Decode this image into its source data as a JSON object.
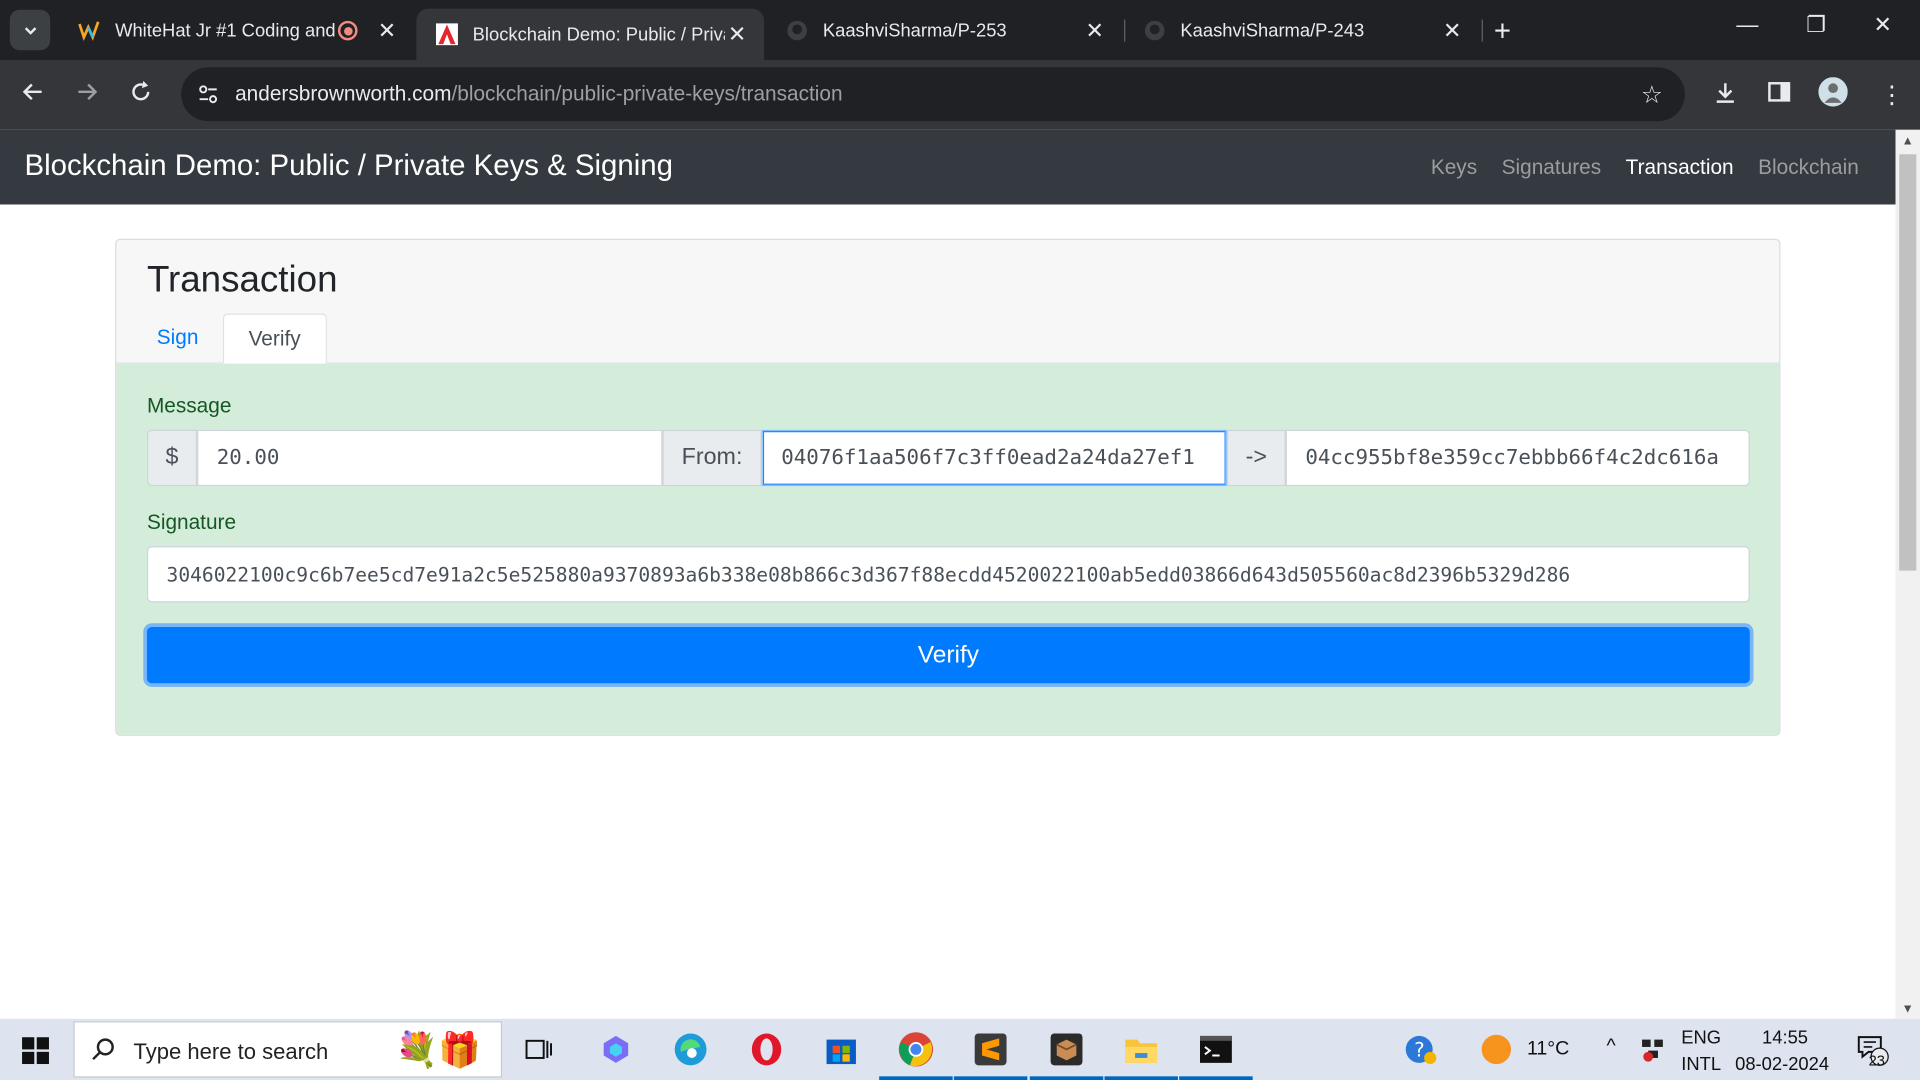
{
  "browser": {
    "tabs": [
      {
        "title": "WhiteHat Jr #1 Coding and",
        "favicon": "whitehat-logo",
        "active": false
      },
      {
        "title": "Blockchain Demo: Public / Priva",
        "favicon": "adobe-logo",
        "active": true
      },
      {
        "title": "KaashviSharma/P-253",
        "favicon": "github-logo",
        "active": false
      },
      {
        "title": "KaashviSharma/P-243",
        "favicon": "github-logo",
        "active": false
      }
    ],
    "url_host": "andersbrownworth.com",
    "url_path": "/blockchain/public-private-keys/transaction"
  },
  "navbar": {
    "brand": "Blockchain Demo: Public / Private Keys & Signing",
    "links": [
      "Keys",
      "Signatures",
      "Transaction",
      "Blockchain"
    ],
    "active_link": "Transaction"
  },
  "card": {
    "title": "Transaction",
    "tabs": [
      "Sign",
      "Verify"
    ],
    "active_tab": "Verify",
    "message_label": "Message",
    "currency_symbol": "$",
    "amount": "20.00",
    "from_label": "From:",
    "from_value": "04076f1aa506f7c3ff0ead2a24da27ef1",
    "arrow_label": "->",
    "to_value": "04cc955bf8e359cc7ebbb66f4c2dc616a",
    "signature_label": "Signature",
    "signature_value": "3046022100c9c6b7ee5cd7e91a2c5e525880a9370893a6b338e08b866c3d367f88ecdd4520022100ab5edd03866d643d505560ac8d2396b5329d286",
    "verify_button": "Verify"
  },
  "taskbar": {
    "search_placeholder": "Type here to search",
    "weather": "11°C",
    "language_top": "ENG",
    "language_bottom": "INTL",
    "time": "14:55",
    "date": "08-02-2024",
    "notification_count": "23"
  },
  "colors": {
    "primary": "#007bff",
    "success_bg": "#d4edda",
    "success_text": "#155724",
    "navbar_bg": "#343a40"
  }
}
